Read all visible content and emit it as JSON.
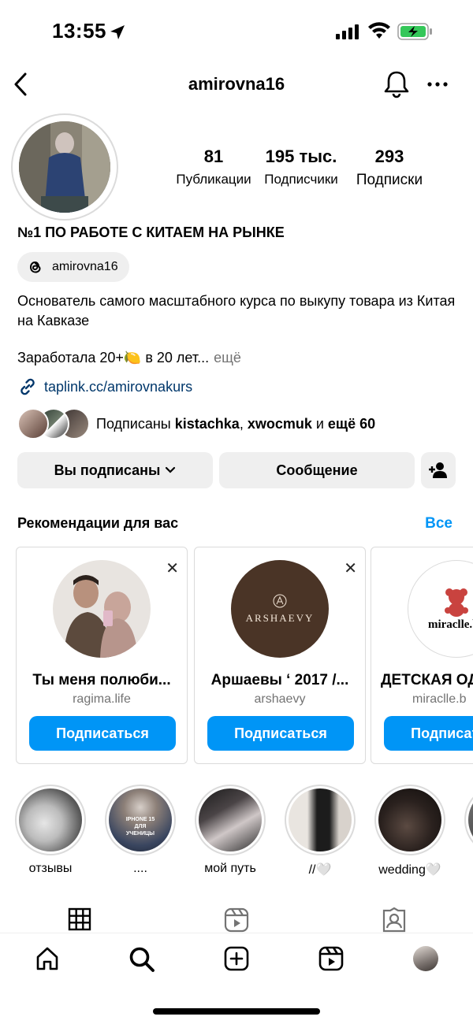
{
  "status_bar": {
    "time": "13:55"
  },
  "header": {
    "title": "amirovna16"
  },
  "profile": {
    "stats": [
      {
        "value": "81",
        "label": "Публикации"
      },
      {
        "value": "195 тыс.",
        "label": "Подписчики"
      },
      {
        "value": "293",
        "label": "Подписки"
      }
    ],
    "display_name": "№1 ПО РАБОТЕ С КИТАЕМ НА РЫНКЕ",
    "threads_handle": "amirovna16",
    "bio_line1": "Основатель самого масштабного курса по выкупу товара из Китая на Кавказе",
    "bio_line2": "Заработала 20+🍋 в 20 лет...",
    "bio_more": "ещё",
    "link": "taplink.cc/amirovnakurs",
    "mutual": {
      "prefix": "Подписаны ",
      "user1": "kistachka",
      "sep": ", ",
      "user2": "xwocmuk",
      "mid": " и ",
      "rest": "ещё 60"
    }
  },
  "actions": {
    "following_label": "Вы подписаны",
    "message_label": "Сообщение"
  },
  "recommendations": {
    "title": "Рекомендации для вас",
    "see_all": "Все",
    "follow_label": "Подписаться",
    "cards": [
      {
        "name": "Ты меня полюби...",
        "handle": "ragima.life"
      },
      {
        "name": "Аршаевы ‘ 2017 /...",
        "handle": "arshaevy",
        "logo_text": "ARSHAEVY"
      },
      {
        "name": "ДЕТСКАЯ ОД",
        "handle": "miraclle.b",
        "logo_text": "miraclle.ba"
      }
    ]
  },
  "highlights": [
    {
      "label": "отзывы"
    },
    {
      "label": "....",
      "overlay": "IPHONE 15 ДЛЯ УЧЕНИЦЫ"
    },
    {
      "label": "мой путь"
    },
    {
      "label": "//🤍"
    },
    {
      "label": "wedding🤍"
    }
  ],
  "colors": {
    "accent": "#0095f6",
    "link": "#00376b",
    "secondary": "#737373",
    "button_bg": "#efefef"
  }
}
